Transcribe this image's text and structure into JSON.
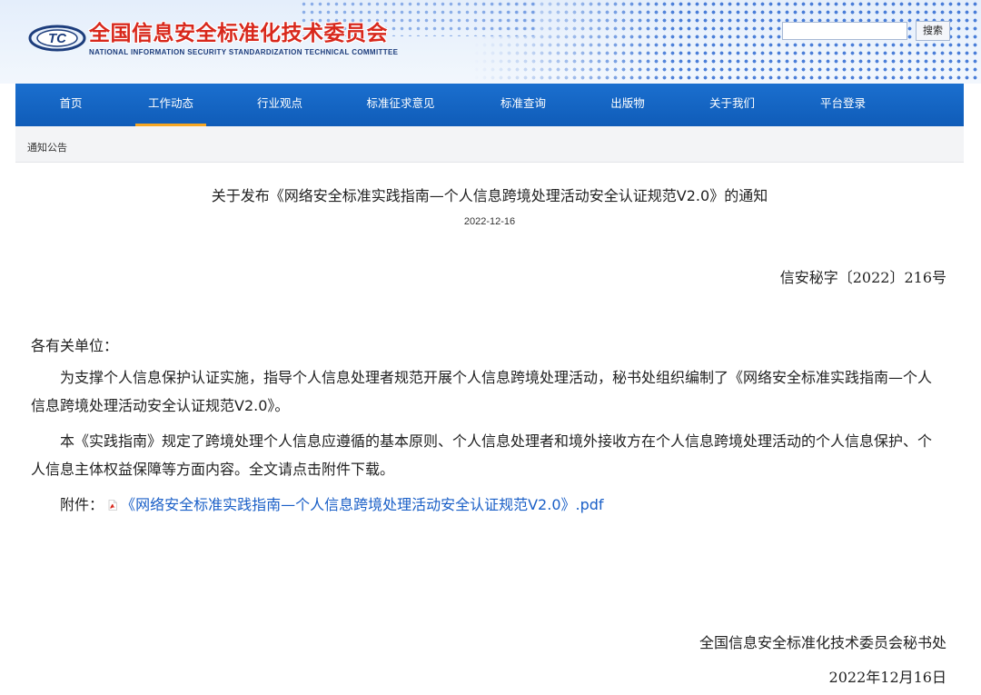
{
  "header": {
    "logo_cn": "全国信息安全标准化技术委员会",
    "logo_en": "NATIONAL INFORMATION SECURITY STANDARDIZATION TECHNICAL COMMITTEE",
    "logo_icon_text": "TC",
    "search_placeholder": "",
    "search_button": "搜索"
  },
  "nav": {
    "items": [
      {
        "label": "首页"
      },
      {
        "label": "工作动态",
        "active": true
      },
      {
        "label": "行业观点"
      },
      {
        "label": "标准征求意见"
      },
      {
        "label": "标准查询"
      },
      {
        "label": "出版物"
      },
      {
        "label": "关于我们"
      },
      {
        "label": "平台登录"
      }
    ]
  },
  "breadcrumb": "通知公告",
  "article": {
    "title": "关于发布《网络安全标准实践指南—个人信息跨境处理活动安全认证规范V2.0》的通知",
    "date": "2022-12-16",
    "doc_number": "信安秘字〔2022〕216号",
    "salutation": "各有关单位：",
    "paragraphs": [
      "为支撑个人信息保护认证实施，指导个人信息处理者规范开展个人信息跨境处理活动，秘书处组织编制了《网络安全标准实践指南—个人信息跨境处理活动安全认证规范V2.0》。",
      "本《实践指南》规定了跨境处理个人信息应遵循的基本原则、个人信息处理者和境外接收方在个人信息跨境处理活动的个人信息保护、个人信息主体权益保障等方面内容。全文请点击附件下载。"
    ],
    "attachment_label": "附件：",
    "attachment_link": "《网络安全标准实践指南—个人信息跨境处理活动安全认证规范V2.0》.pdf",
    "signer": "全国信息安全标准化技术委员会秘书处",
    "sign_date": "2022年12月16日"
  },
  "colors": {
    "nav_bg": "#1565c8",
    "nav_active_underline": "#f5a623",
    "logo_red": "#d8281c",
    "link_blue": "#1a5fc7"
  }
}
